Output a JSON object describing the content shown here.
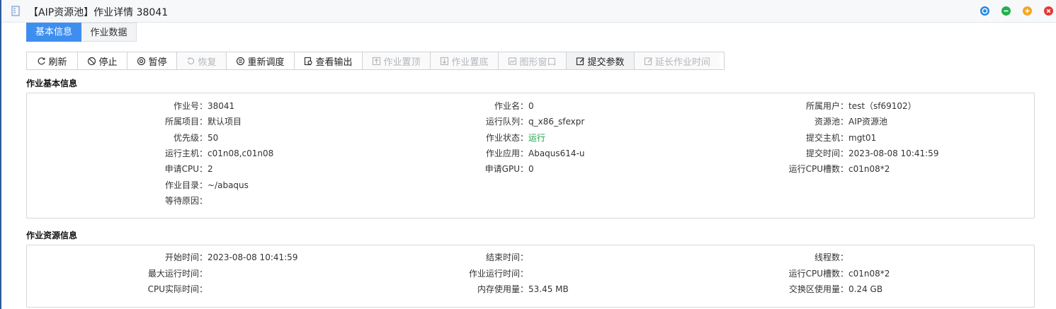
{
  "window": {
    "title": "【AIP资源池】作业详情 38041",
    "controls": [
      {
        "name": "window-settings-icon",
        "color": "#1e88e5"
      },
      {
        "name": "window-minimize-icon",
        "color": "#22b14c"
      },
      {
        "name": "window-maximize-icon",
        "color": "#f5a623"
      },
      {
        "name": "window-close-icon",
        "color": "#e53935"
      }
    ]
  },
  "tabs": [
    {
      "label": "基本信息",
      "active": true
    },
    {
      "label": "作业数据",
      "active": false
    }
  ],
  "toolbar": {
    "buttons": [
      {
        "label": "刷新",
        "icon": "refresh-icon",
        "enabled": true
      },
      {
        "label": "停止",
        "icon": "stop-icon",
        "enabled": true
      },
      {
        "label": "暂停",
        "icon": "pause-icon",
        "enabled": true
      },
      {
        "label": "恢复",
        "icon": "resume-icon",
        "enabled": false
      },
      {
        "label": "重新调度",
        "icon": "reschedule-icon",
        "enabled": true
      },
      {
        "label": "查看输出",
        "icon": "view-output-icon",
        "enabled": true
      },
      {
        "label": "作业置顶",
        "icon": "move-top-icon",
        "enabled": false
      },
      {
        "label": "作业置底",
        "icon": "move-bottom-icon",
        "enabled": false
      },
      {
        "label": "图形窗口",
        "icon": "graphic-window-icon",
        "enabled": false
      },
      {
        "label": "提交参数",
        "icon": "edit-params-icon",
        "enabled": true
      },
      {
        "label": "延长作业时间",
        "icon": "extend-time-icon",
        "enabled": false
      }
    ]
  },
  "basic_info": {
    "title": "作业基本信息",
    "col1": [
      {
        "label": "作业号：",
        "value": "38041"
      },
      {
        "label": "所属项目：",
        "value": "默认项目"
      },
      {
        "label": "优先级：",
        "value": "50"
      },
      {
        "label": "运行主机：",
        "value": "c01n08,c01n08"
      },
      {
        "label": "申请CPU：",
        "value": "2"
      },
      {
        "label": "作业目录：",
        "value": "~/abaqus"
      },
      {
        "label": "等待原因：",
        "value": ""
      }
    ],
    "col2": [
      {
        "label": "作业名：",
        "value": "0"
      },
      {
        "label": "运行队列：",
        "value": "q_x86_sfexpr"
      },
      {
        "label": "作业状态：",
        "value": "运行",
        "status_color": "#1aa34a"
      },
      {
        "label": "作业应用：",
        "value": "Abaqus614-u"
      },
      {
        "label": "申请GPU：",
        "value": "0"
      }
    ],
    "col3": [
      {
        "label": "所属用户：",
        "value": "test（sf69102）"
      },
      {
        "label": "资源池：",
        "value": "AIP资源池"
      },
      {
        "label": "提交主机：",
        "value": "mgt01"
      },
      {
        "label": "提交时间：",
        "value": "2023-08-08 10:41:59"
      },
      {
        "label": "运行CPU槽数：",
        "value": "c01n08*2"
      }
    ]
  },
  "resource_info": {
    "title": "作业资源信息",
    "col1": [
      {
        "label": "开始时间：",
        "value": "2023-08-08 10:41:59"
      },
      {
        "label": "最大运行时间：",
        "value": ""
      },
      {
        "label": "CPU实际时间：",
        "value": ""
      }
    ],
    "col2": [
      {
        "label": "结束时间：",
        "value": ""
      },
      {
        "label": "作业运行时间：",
        "value": ""
      },
      {
        "label": "内存使用量：",
        "value": "53.45 MB"
      }
    ],
    "col3": [
      {
        "label": "线程数：",
        "value": ""
      },
      {
        "label": "运行CPU槽数：",
        "value": "c01n08*2"
      },
      {
        "label": "交换区使用量：",
        "value": "0.24 GB"
      }
    ]
  },
  "colors": {
    "accent": "#3e8ef0",
    "status_running": "#1aa34a",
    "disabled_text": "#b3b7bd"
  }
}
